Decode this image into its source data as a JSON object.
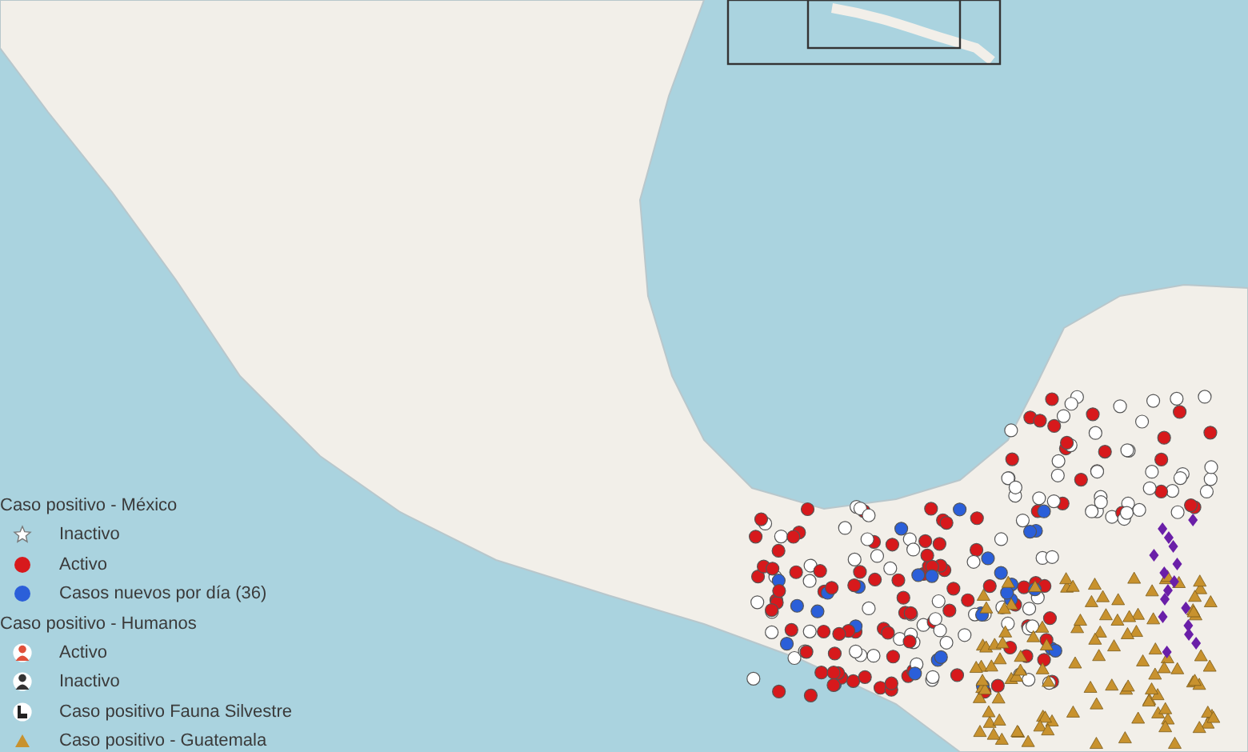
{
  "legend": {
    "sections": [
      {
        "title": "Caso positivo - México",
        "items": [
          {
            "kind": "star",
            "color": "#ffffff",
            "label": "Inactivo"
          },
          {
            "kind": "dot",
            "color": "#d7191c",
            "label": "Activo"
          },
          {
            "kind": "dot",
            "color": "#2b5fd9",
            "label": "Casos nuevos por día (36)"
          }
        ]
      },
      {
        "title": "Caso positivo - Humanos",
        "items": [
          {
            "kind": "person",
            "color": "#e0503a",
            "label": "Activo"
          },
          {
            "kind": "person",
            "color": "#333333",
            "label": "Inactivo"
          },
          {
            "kind": "animal",
            "color": "#222222",
            "label": "Caso positivo Fauna Silvestre"
          },
          {
            "kind": "triangle",
            "color": "#c8922e",
            "label": "Caso positivo - Guatemala"
          }
        ]
      }
    ]
  }
}
